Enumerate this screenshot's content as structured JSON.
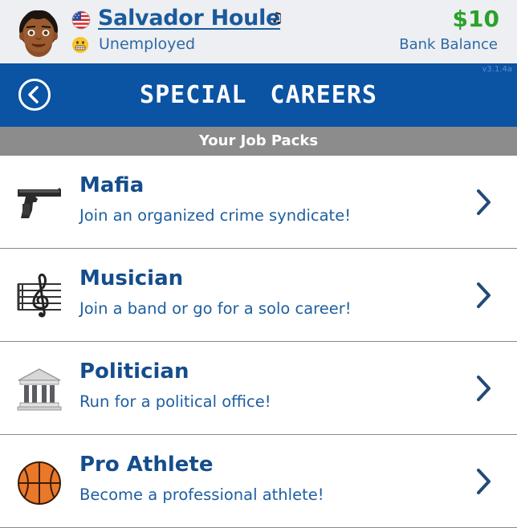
{
  "header": {
    "player_name": "Salvador Houle",
    "music_icon": "♫",
    "status": "Unemployed",
    "balance": "$10",
    "balance_label": "Bank Balance"
  },
  "titlebar": {
    "title": "SPECIAL CAREERS",
    "version": "v3.1.4a"
  },
  "section": {
    "label": "Your Job Packs"
  },
  "jobs": [
    {
      "title": "Mafia",
      "subtitle": "Join an organized crime syndicate!",
      "icon": "pistol-icon"
    },
    {
      "title": "Musician",
      "subtitle": "Join a band or go for a solo career!",
      "icon": "treble-clef-icon"
    },
    {
      "title": "Politician",
      "subtitle": "Run for a political office!",
      "icon": "government-building-icon"
    },
    {
      "title": "Pro Athlete",
      "subtitle": "Become a professional athlete!",
      "icon": "basketball-icon"
    }
  ],
  "colors": {
    "brand_blue": "#0b53a3",
    "money_green": "#2aa22a",
    "section_gray": "#8c8c8c"
  }
}
